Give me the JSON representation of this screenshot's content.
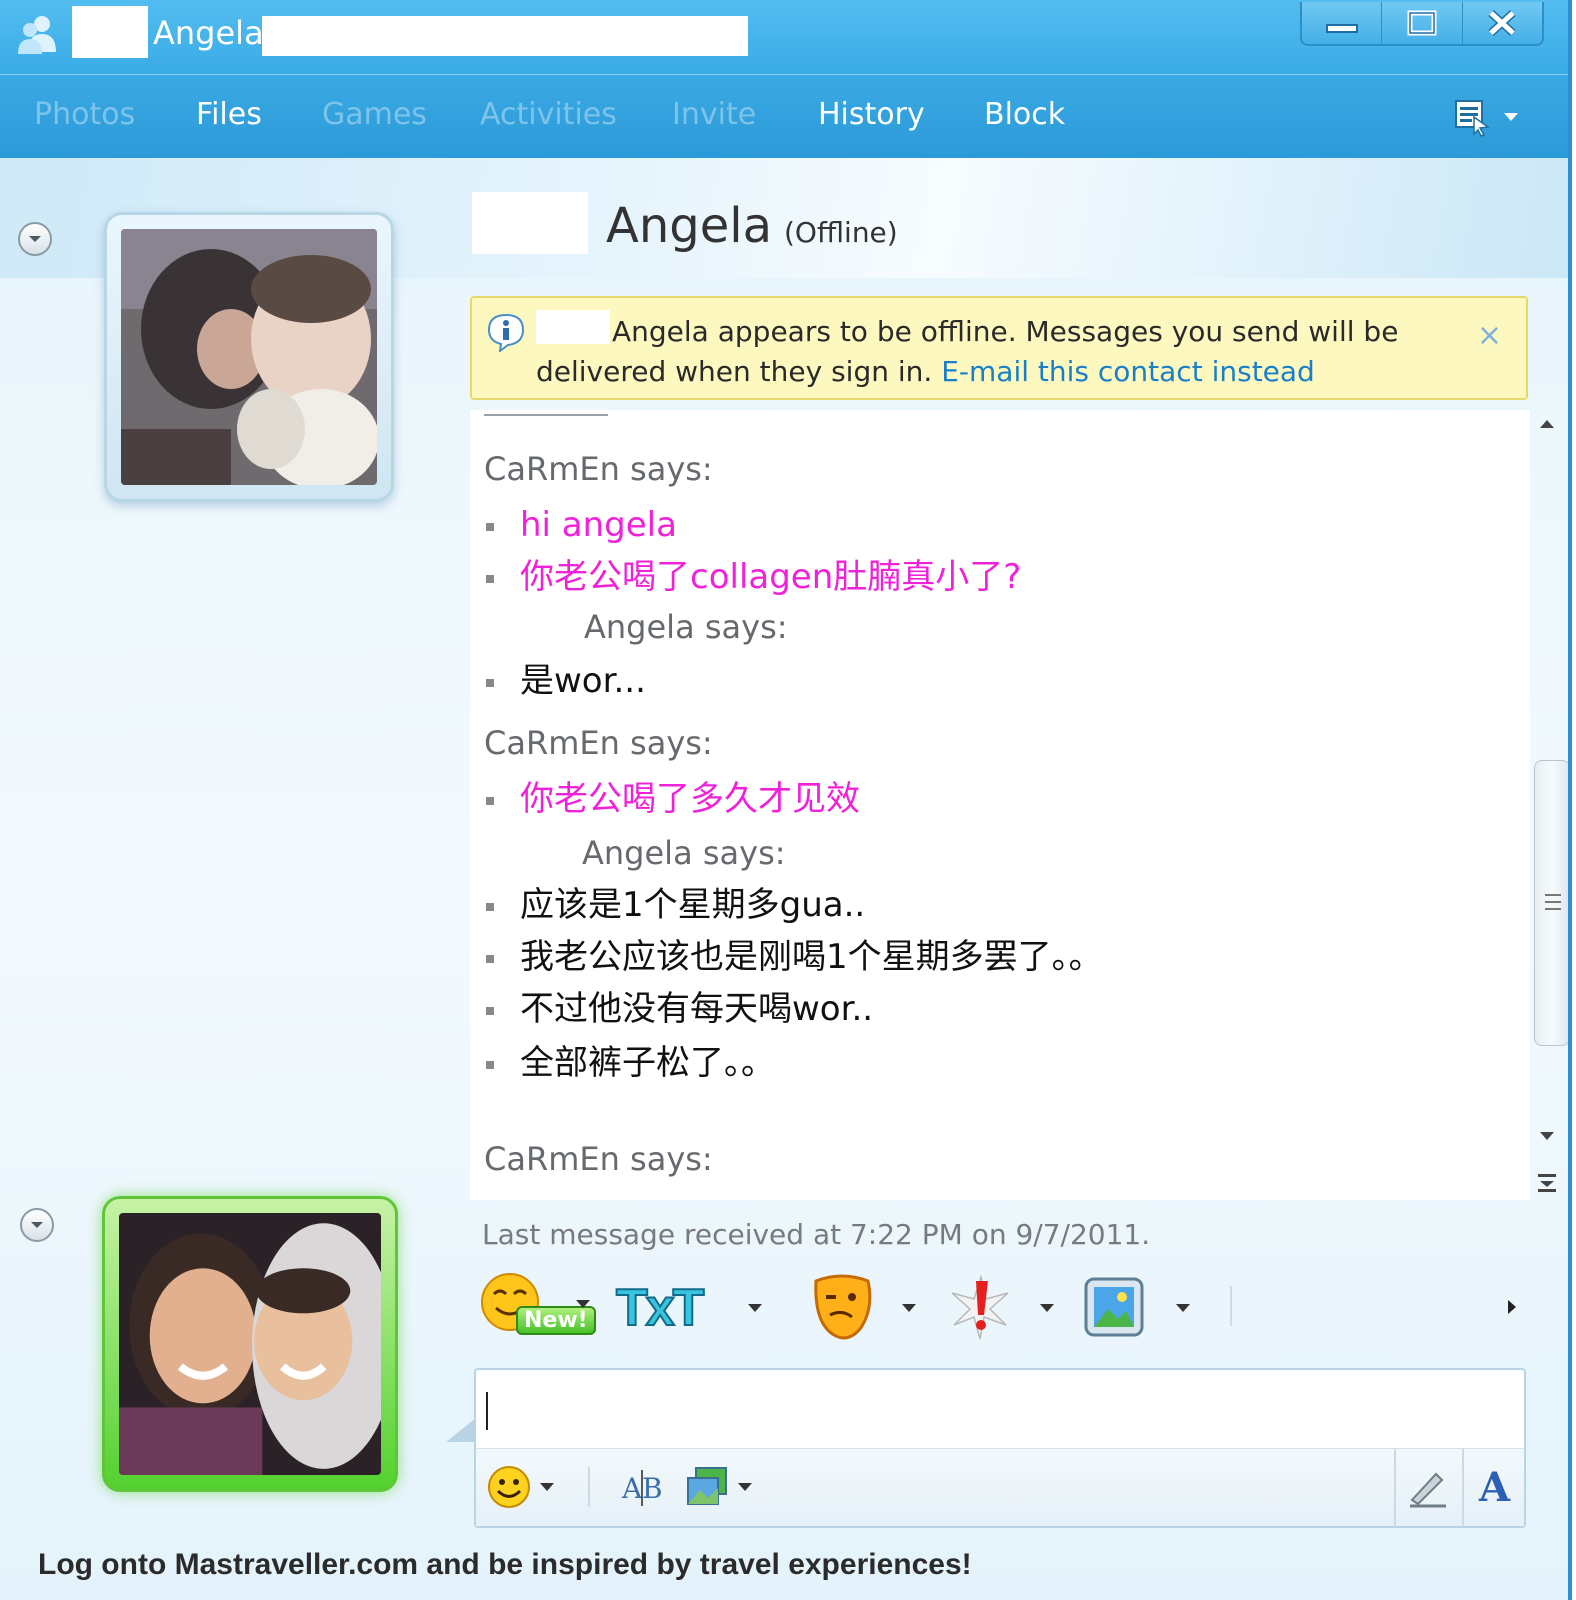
{
  "window": {
    "title": "Angela"
  },
  "toolbar": {
    "items": [
      {
        "label": "Photos",
        "enabled": false
      },
      {
        "label": "Files",
        "enabled": true
      },
      {
        "label": "Games",
        "enabled": false
      },
      {
        "label": "Activities",
        "enabled": false
      },
      {
        "label": "Invite",
        "enabled": false
      },
      {
        "label": "History",
        "enabled": true
      },
      {
        "label": "Block",
        "enabled": true
      }
    ],
    "options_icon": "show-menu-icon"
  },
  "contact": {
    "name": "Angela",
    "status": "(Offline)"
  },
  "infobar": {
    "text_prefix": "Angela appears to be offline. Messages you send will be delivered when they sign in.",
    "link": "E-mail this contact instead",
    "close": "×"
  },
  "conversation": {
    "blocks": [
      {
        "sender": "CaRmEn says:",
        "messages": [
          "hi angela",
          "你老公喝了collagen肚腩真小了?"
        ]
      },
      {
        "sender": "Angela says:",
        "messages": [
          "是wor..."
        ]
      },
      {
        "sender": "CaRmEn says:",
        "messages": [
          "你老公喝了多久才见效"
        ]
      },
      {
        "sender": "Angela says:",
        "messages": [
          "应该是1个星期多gua..",
          "我老公应该也是刚喝1个星期多罢了。。",
          "不过他没有每天喝wor..",
          "全部裤子松了。。"
        ]
      },
      {
        "sender": "CaRmEn says:",
        "messages": []
      }
    ]
  },
  "status_line": "Last message received at 7:22 PM on 9/7/2011.",
  "emoticon_bar": {
    "new_badge": "New!",
    "txt_label": "TxT"
  },
  "input": {
    "value": "",
    "placeholder": ""
  },
  "format_tools": {
    "font_label": "A"
  },
  "footer": "Log onto Mastraveller.com and be inspired by travel experiences!",
  "colors": {
    "titlebar": "#3aabe6",
    "own_message": "#f021d8",
    "link": "#1a7fc9",
    "infobar_bg": "#fcf8bf"
  }
}
